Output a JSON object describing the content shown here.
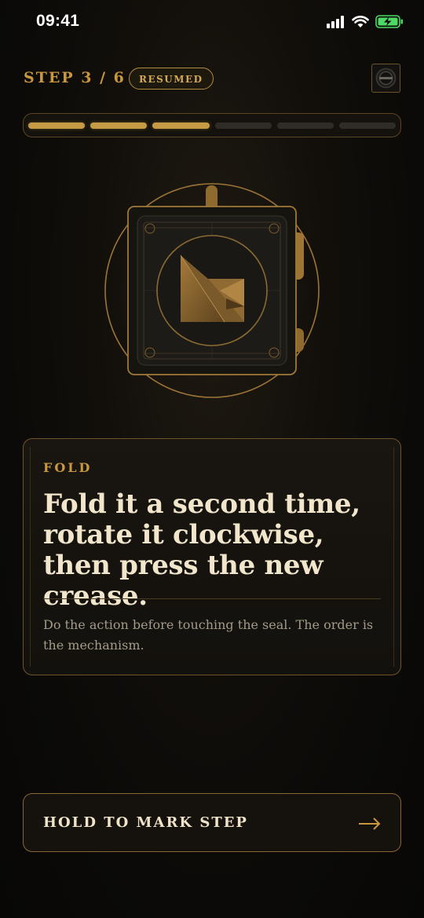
{
  "status": {
    "time": "09:41"
  },
  "header": {
    "step_label": "STEP 3 / 6",
    "badge": "RESUMED"
  },
  "progress": {
    "current": 3,
    "total": 6
  },
  "card": {
    "kicker": "FOLD",
    "title": "Fold it a second time, rotate it clockwise, then press the new crease.",
    "note": "Do the action before touching the seal. The order is the mechanism."
  },
  "action": {
    "label": "HOLD TO MARK STEP"
  },
  "colors": {
    "accent": "#c59a45",
    "text": "#f1e5cb",
    "muted": "#a39a89"
  },
  "icons": {
    "hero": "folded-paper-seal-icon",
    "arrow": "arrow-right-icon",
    "avatar": "seal-avatar-icon"
  }
}
